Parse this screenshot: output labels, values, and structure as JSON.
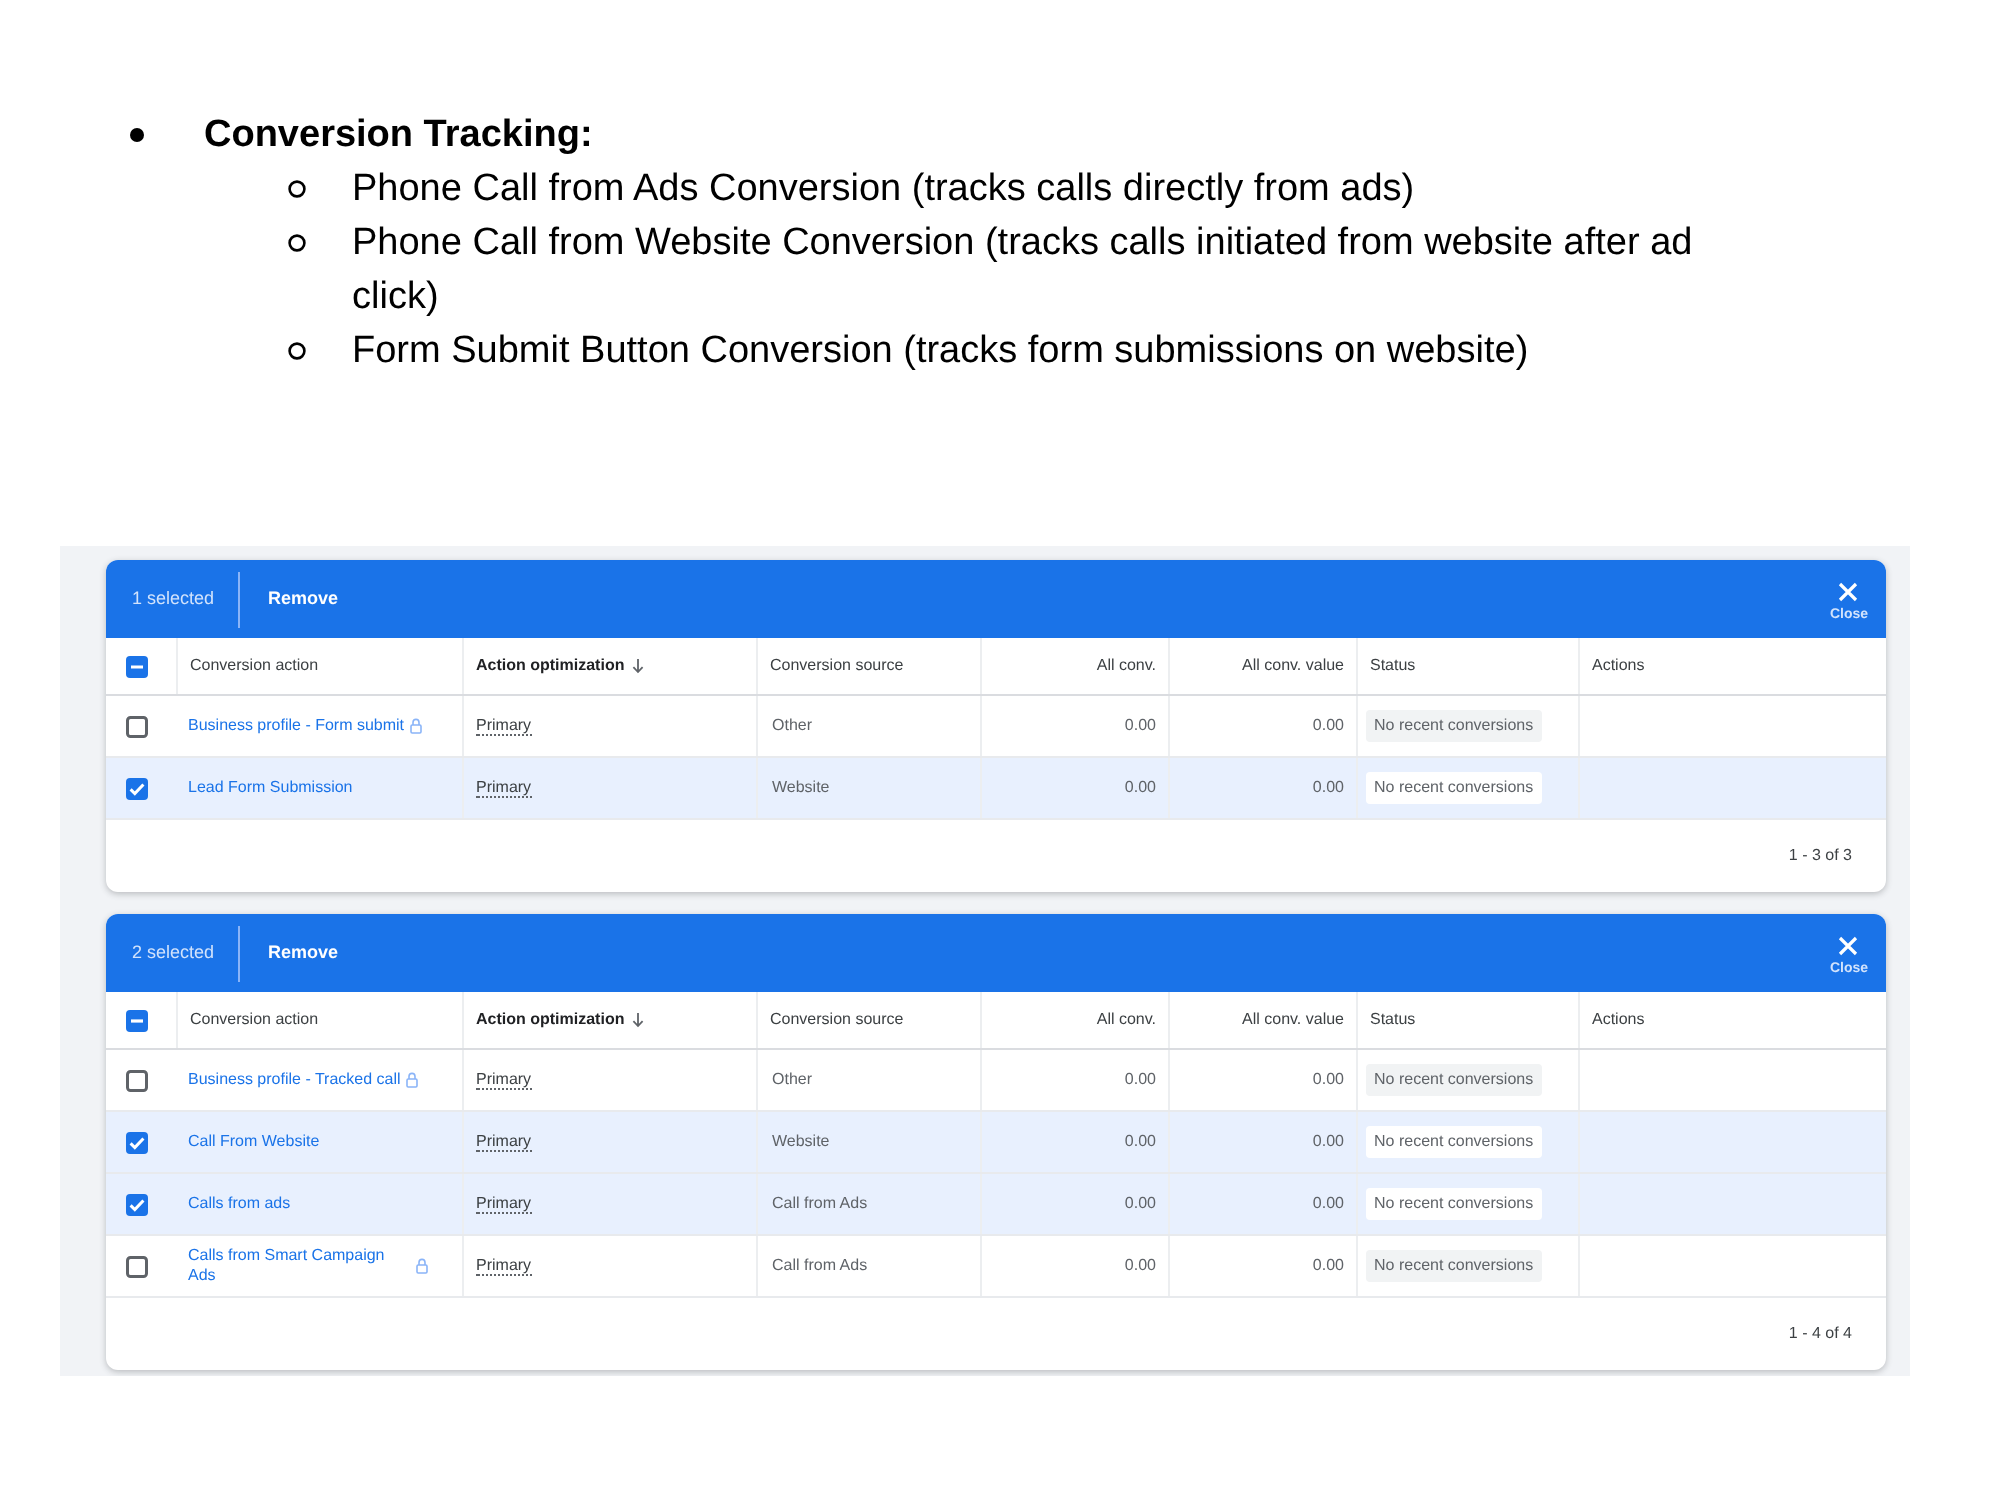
{
  "document": {
    "items": [
      {
        "text": "Conversion Tracking:",
        "children": [
          {
            "text": "Phone Call from Ads Conversion (tracks calls directly from ads)"
          },
          {
            "text": "Phone Call from Website Conversion (tracks calls initiated from website after ad click)"
          },
          {
            "text": "Form Submit Button Conversion (tracks form submissions on website)"
          }
        ]
      }
    ]
  },
  "screenshot": {
    "tables": [
      {
        "selection_bar": {
          "count": "1 selected",
          "remove": "Remove",
          "close": "Close"
        },
        "select_all_indeterminate": true,
        "columns": [
          {
            "label": "Conversion action",
            "kind": "name",
            "sorted": false
          },
          {
            "label": "Action optimization",
            "kind": "optimization",
            "sorted": true
          },
          {
            "label": "Conversion source",
            "kind": "text",
            "sorted": false
          },
          {
            "label": "All conv.",
            "kind": "number",
            "sorted": false
          },
          {
            "label": "All conv. value",
            "kind": "number",
            "sorted": false
          },
          {
            "label": "Status",
            "kind": "status",
            "sorted": false
          },
          {
            "label": "Actions",
            "kind": "actions",
            "sorted": false
          }
        ],
        "rows": [
          {
            "selected": false,
            "locked": true,
            "cells": [
              "Business profile - Form submit",
              "Primary",
              "Other",
              "0.00",
              "0.00",
              "No recent conversions"
            ]
          },
          {
            "selected": true,
            "locked": false,
            "cells": [
              "Lead Form Submission",
              "Primary",
              "Website",
              "0.00",
              "0.00",
              "No recent conversions"
            ]
          }
        ],
        "pagination": "1 - 3 of 3"
      },
      {
        "selection_bar": {
          "count": "2 selected",
          "remove": "Remove",
          "close": "Close"
        },
        "select_all_indeterminate": true,
        "columns": [
          {
            "label": "Conversion action",
            "kind": "name",
            "sorted": false
          },
          {
            "label": "Action optimization",
            "kind": "optimization",
            "sorted": true
          },
          {
            "label": "Conversion source",
            "kind": "text",
            "sorted": false
          },
          {
            "label": "All conv.",
            "kind": "number",
            "sorted": false
          },
          {
            "label": "All conv. value",
            "kind": "number",
            "sorted": false
          },
          {
            "label": "Status",
            "kind": "status",
            "sorted": false
          },
          {
            "label": "Actions",
            "kind": "actions",
            "sorted": false
          }
        ],
        "rows": [
          {
            "selected": false,
            "locked": true,
            "cells": [
              "Business profile - Tracked call",
              "Primary",
              "Other",
              "0.00",
              "0.00",
              "No recent conversions"
            ]
          },
          {
            "selected": true,
            "locked": false,
            "cells": [
              "Call From Website",
              "Primary",
              "Website",
              "0.00",
              "0.00",
              "No recent conversions"
            ]
          },
          {
            "selected": true,
            "locked": false,
            "cells": [
              "Calls from ads",
              "Primary",
              "Call from Ads",
              "0.00",
              "0.00",
              "No recent conversions"
            ]
          },
          {
            "selected": false,
            "locked": true,
            "cells": [
              "Calls from Smart Campaign Ads",
              "Primary",
              "Call from Ads",
              "0.00",
              "0.00",
              "No recent conversions"
            ]
          }
        ],
        "pagination": "1 - 4 of 4"
      }
    ]
  }
}
